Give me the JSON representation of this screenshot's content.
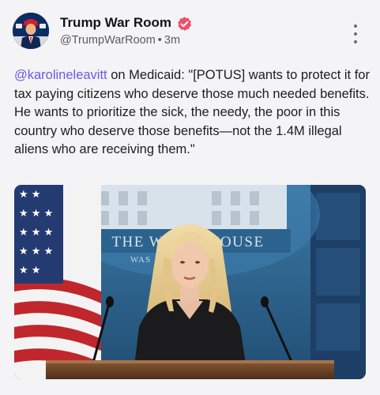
{
  "post": {
    "author": {
      "name": "Trump War Room",
      "handle": "@TrumpWarRoom",
      "separator": "•",
      "time": "3m",
      "avatar_icon": "campaign-logo-avatar",
      "verified_icon": "verified-badge-icon"
    },
    "menu_icon": "more-vertical-icon",
    "text": {
      "mention": "@karolineleavitt",
      "body": " on Medicaid: \"[POTUS] wants to protect it for tax paying citizens who deserve those much needed benefits. He wants to prioritize the sick, the needy, the poor in this country who deserve those benefits—not the 1.4M illegal aliens who are receiving them.\""
    },
    "media": {
      "backdrop_text": "THE WHITE HOUSE",
      "backdrop_subtext": "WAS"
    }
  },
  "colors": {
    "mention": "#6e58ea",
    "verified": "#ef4f6a",
    "background": "#f4f3f6",
    "backdrop_blue": "#2e6089"
  }
}
